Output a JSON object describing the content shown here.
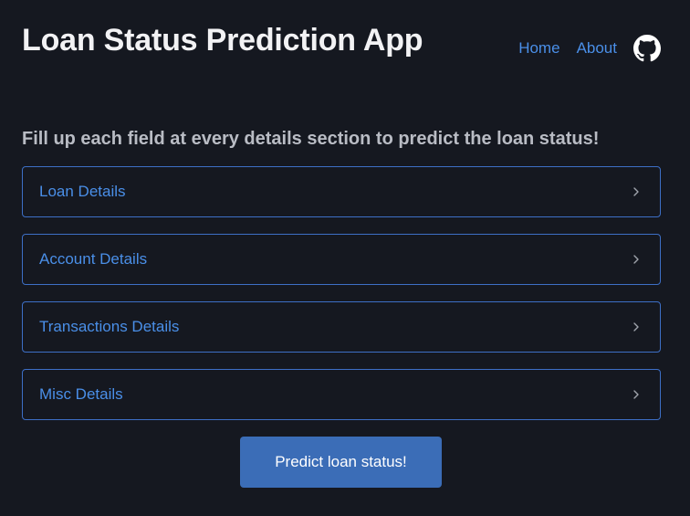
{
  "header": {
    "title": "Loan Status Prediction App",
    "nav": {
      "home_label": "Home",
      "about_label": "About",
      "github_icon": "github-icon"
    }
  },
  "main": {
    "instructions": "Fill up each field at every details section to predict the loan status!",
    "sections": [
      {
        "label": "Loan Details",
        "expanded": false
      },
      {
        "label": "Account Details",
        "expanded": false
      },
      {
        "label": "Transactions Details",
        "expanded": false
      },
      {
        "label": "Misc Details",
        "expanded": false
      }
    ],
    "predict_label": "Predict loan status!"
  },
  "colors": {
    "background": "#151820",
    "accent": "#4a8fe8",
    "border": "#3d6fc6",
    "button": "#3b6db7"
  }
}
